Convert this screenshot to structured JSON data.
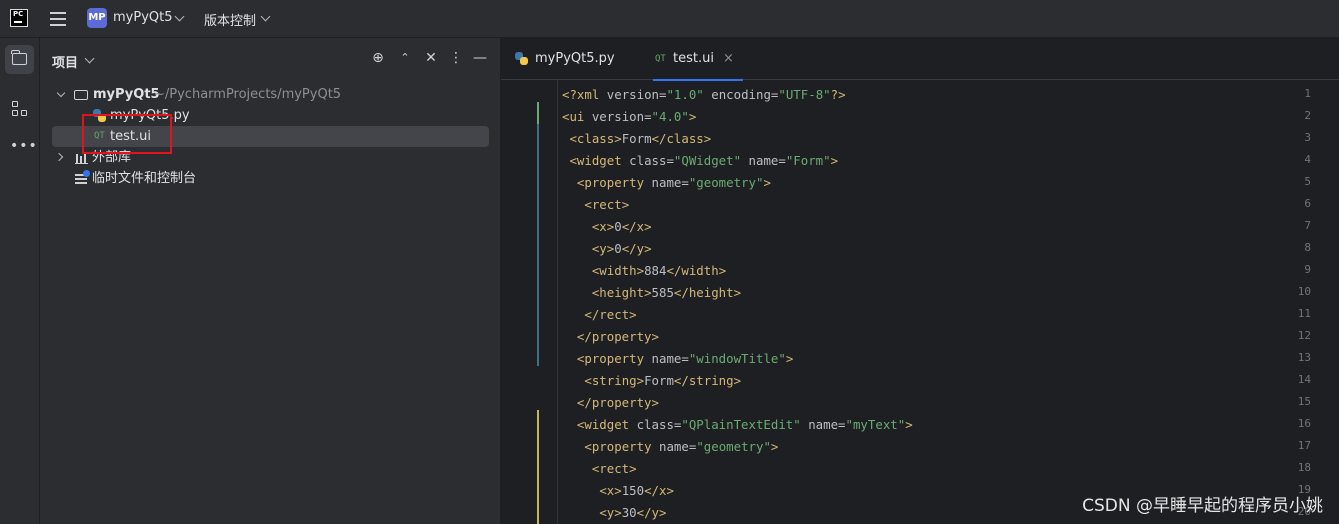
{
  "titlebar": {
    "logo_text": "PC",
    "project_badge": "MP",
    "project_name": "myPyQt5",
    "vcs_label": "版本控制"
  },
  "project_panel": {
    "title": "项目",
    "tree": [
      {
        "label": "myPyQt5",
        "path": "~/PycharmProjects/myPyQt5",
        "type": "folder",
        "expanded": true
      },
      {
        "label": "myPyQt5.py",
        "type": "python-file"
      },
      {
        "label": "test.ui",
        "type": "qt-ui-file",
        "selected": true
      },
      {
        "label": "外部库",
        "type": "library",
        "expanded": false
      },
      {
        "label": "临时文件和控制台",
        "type": "scratches"
      }
    ],
    "qt_icon_text": "QT"
  },
  "editor": {
    "tabs": [
      {
        "label": "myPyQt5.py",
        "active": false
      },
      {
        "label": "test.ui",
        "active": true,
        "close": "×"
      }
    ],
    "lines": [
      {
        "n": "1",
        "code": "<?xml version=\"1.0\" encoding=\"UTF-8\"?>"
      },
      {
        "n": "2",
        "code": "<ui version=\"4.0\">"
      },
      {
        "n": "3",
        "code": " <class>Form</class>"
      },
      {
        "n": "4",
        "code": " <widget class=\"QWidget\" name=\"Form\">"
      },
      {
        "n": "5",
        "code": "  <property name=\"geometry\">"
      },
      {
        "n": "6",
        "code": "   <rect>"
      },
      {
        "n": "7",
        "code": "    <x>0</x>"
      },
      {
        "n": "8",
        "code": "    <y>0</y>"
      },
      {
        "n": "9",
        "code": "    <width>884</width>"
      },
      {
        "n": "10",
        "code": "    <height>585</height>"
      },
      {
        "n": "11",
        "code": "   </rect>"
      },
      {
        "n": "12",
        "code": "  </property>"
      },
      {
        "n": "13",
        "code": "  <property name=\"windowTitle\">"
      },
      {
        "n": "14",
        "code": "   <string>Form</string>"
      },
      {
        "n": "15",
        "code": "  </property>"
      },
      {
        "n": "16",
        "code": "  <widget class=\"QPlainTextEdit\" name=\"myText\">"
      },
      {
        "n": "17",
        "code": "   <property name=\"geometry\">"
      },
      {
        "n": "18",
        "code": "    <rect>"
      },
      {
        "n": "19",
        "code": "     <x>150</x>"
      },
      {
        "n": "20",
        "code": "     <y>30</y>"
      }
    ]
  },
  "watermark": "CSDN @早睡早起的程序员小姚",
  "colors": {
    "accent": "#3574f0",
    "annotation": "#e0141c"
  }
}
